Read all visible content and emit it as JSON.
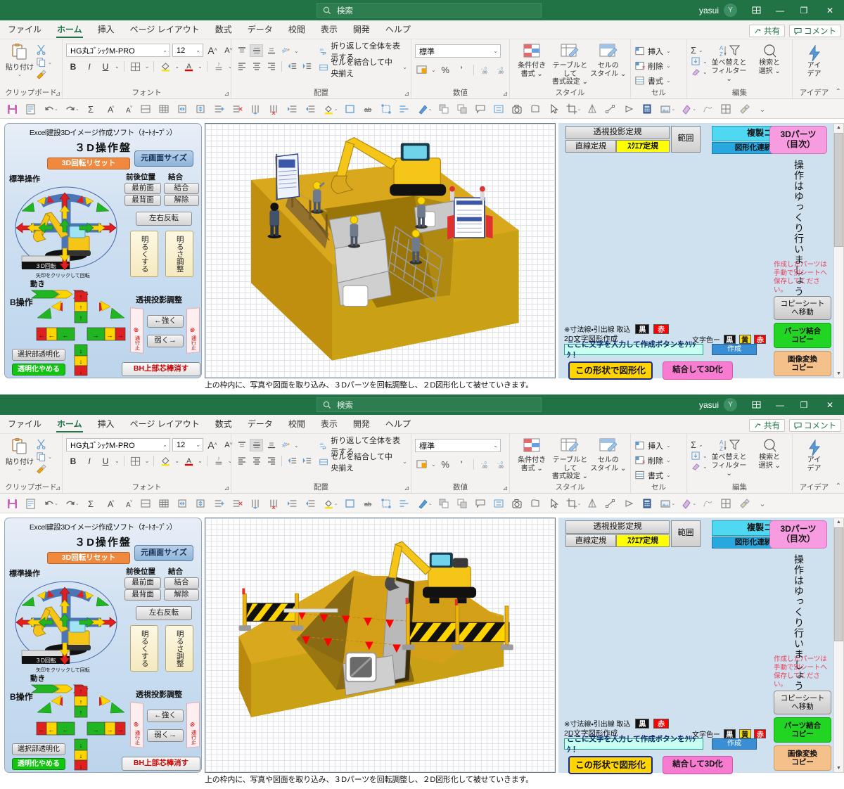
{
  "window": {
    "title": "Excel建設３Dイメージ作成ソフト",
    "title_caret": "▾",
    "search_placeholder": "検索",
    "user": "yasui",
    "avatar_initial": "Y",
    "restore_icon": "restore-window-icon",
    "minimize": "—",
    "maximize": "❐",
    "close": "✕"
  },
  "tabs": [
    {
      "label": "ファイル",
      "active": false
    },
    {
      "label": "ホーム",
      "active": true
    },
    {
      "label": "挿入",
      "active": false
    },
    {
      "label": "ページ レイアウト",
      "active": false
    },
    {
      "label": "数式",
      "active": false
    },
    {
      "label": "データ",
      "active": false
    },
    {
      "label": "校閲",
      "active": false
    },
    {
      "label": "表示",
      "active": false
    },
    {
      "label": "開発",
      "active": false
    },
    {
      "label": "ヘルプ",
      "active": false
    }
  ],
  "tabs_right": [
    {
      "label": "共有",
      "icon": "share-icon"
    },
    {
      "label": "コメント",
      "icon": "comment-icon"
    }
  ],
  "ribbon": {
    "clipboard": {
      "group_label": "クリップボード",
      "paste": "貼り付け",
      "cut_icon": "scissors-icon",
      "copy_icon": "copy-icon",
      "format_painter_icon": "format-painter-icon"
    },
    "font": {
      "group_label": "フォント",
      "font_name": "HG丸ｺﾞｼｯｸM-PRO",
      "font_size": "12",
      "grow": "A",
      "shrink": "A",
      "bold": "B",
      "italic": "I",
      "underline": "U",
      "borders_icon": "borders-icon",
      "fill_icon": "fill-color-icon",
      "font_color_icon": "font-color-icon",
      "phonetic_icon": "phonetic-guide-icon"
    },
    "alignment": {
      "group_label": "配置",
      "wrap_text": "折り返して全体を表示する",
      "merge_center": "セルを結合して中央揃え",
      "orientation_icon": "text-orientation-icon",
      "indent_decrease_icon": "indent-decrease-icon",
      "indent_increase_icon": "indent-increase-icon"
    },
    "number": {
      "group_label": "数値",
      "format": "標準",
      "accounting_icon": "accounting-format-icon",
      "percent": "%",
      "comma": "'",
      "inc_decimal_icon": "increase-decimal-icon",
      "dec_decimal_icon": "decrease-decimal-icon"
    },
    "styles": {
      "group_label": "スタイル",
      "conditional": "条件付き\n書式",
      "conditional_l1": "条件付き",
      "conditional_l2": "書式",
      "table_l1": "テーブルとして",
      "table_l2": "書式設定",
      "cellstyle_l1": "セルの",
      "cellstyle_l2": "スタイル"
    },
    "cells": {
      "group_label": "セル",
      "insert": "挿入",
      "delete": "削除",
      "format": "書式"
    },
    "editing": {
      "group_label": "編集",
      "sum_icon": "autosum-icon",
      "fill_icon": "fill-down-icon",
      "clear_icon": "clear-icon",
      "sort_l1": "並べ替えと",
      "sort_l2": "フィルター",
      "find_l1": "検索と",
      "find_l2": "選択"
    },
    "ideas": {
      "group_label": "アイデア",
      "l1": "アイ",
      "l2": "デア"
    },
    "collapse_icon": "collapse-ribbon-icon"
  },
  "quick_toolbar": [
    {
      "name": "save-icon",
      "caret": false
    },
    {
      "name": "print-preview-icon",
      "caret": false
    },
    {
      "name": "undo-icon",
      "caret": true
    },
    {
      "name": "redo-icon",
      "caret": true
    },
    {
      "name": "autosum-icon",
      "caret": false
    },
    {
      "name": "increase-font-icon",
      "caret": false
    },
    {
      "name": "decrease-font-icon",
      "caret": false
    },
    {
      "name": "merge-cells-icon",
      "caret": false
    },
    {
      "name": "all-borders-icon",
      "caret": false
    },
    {
      "name": "row-height-icon",
      "caret": false
    },
    {
      "name": "column-width-icon",
      "caret": false
    },
    {
      "name": "insert-row-icon",
      "caret": false
    },
    {
      "name": "delete-row-icon",
      "caret": false
    },
    {
      "name": "insert-column-icon",
      "caret": false
    },
    {
      "name": "delete-column-icon",
      "caret": false
    },
    {
      "name": "indent-increase-icon",
      "caret": false
    },
    {
      "name": "indent-decrease-icon",
      "caret": false
    },
    {
      "name": "fill-color-icon",
      "caret": true
    },
    {
      "name": "shape-outline-icon",
      "caret": false
    },
    {
      "name": "strikethrough-icon",
      "caret": false
    },
    {
      "name": "group-objects-icon",
      "caret": false
    },
    {
      "name": "align-objects-icon",
      "caret": false
    },
    {
      "name": "pen-icon",
      "caret": true
    },
    {
      "name": "bring-front-icon",
      "caret": false
    },
    {
      "name": "send-back-icon",
      "caret": false
    },
    {
      "name": "comment-icon",
      "caret": false
    },
    {
      "name": "selection-pane-icon",
      "caret": false
    },
    {
      "name": "camera-icon",
      "caret": false
    },
    {
      "name": "shape-icon",
      "caret": false
    },
    {
      "name": "select-arrow-icon",
      "caret": false
    },
    {
      "name": "crop-icon",
      "caret": true
    },
    {
      "name": "flip-icon",
      "caret": false
    },
    {
      "name": "edit-points-icon",
      "caret": false
    },
    {
      "name": "rotate-left-icon",
      "caret": false
    },
    {
      "name": "calculator-icon",
      "caret": false
    },
    {
      "name": "picture-icon",
      "caret": true
    },
    {
      "name": "eraser-icon",
      "caret": true
    },
    {
      "name": "freeform-icon",
      "caret": false
    },
    {
      "name": "insert-cells-icon",
      "caret": false
    },
    {
      "name": "format-painter-icon",
      "caret": false
    },
    {
      "name": "more-commands-icon",
      "caret": false
    }
  ],
  "control_panel": {
    "subtitle": "Excel建設3Dイメージ作成ソフト（ｵｰﾄｵｰﾌﾟﾝ）",
    "heading": "３D操作盤",
    "reset_button": "3D回転リセット",
    "original_size_button": "元画面サイズ",
    "standard_label": "標準操作",
    "zengo_label": "前後位置",
    "ketsugou_label": "結合",
    "front_button": "最前面",
    "back_button": "最背面",
    "join_button": "結合",
    "unjoin_button": "解除",
    "flip_button": "左右反転",
    "brighten_button": "明るくする",
    "brightness_button": "明るさ調整",
    "rotate_hint": "矢印をクリックして回転",
    "move_label": "動き",
    "b_operation_label": "B操作",
    "perspective_label": "透視投影調整",
    "stronger_button": "←強く",
    "weaker_button": "弱く→",
    "select_transparent_button": "選択部透明化",
    "stop_transparent_button": "透明化やめる",
    "bh_button": "BH上部芯棒消す",
    "rotate_base_label": "３D回転",
    "no_entry_sign": "通行止"
  },
  "right_panel": {
    "perspective_ruler": "透視投影定規",
    "line_ruler": "直線定規",
    "square_ruler": "ｽｸｴｱ定規",
    "range_button": "範囲",
    "duplicate_copy": "複製コピー",
    "shape_shrink_copy": "図形化連続縮小ｺﾋﾟｰ",
    "parts_3d_l1": "3Dパーツ",
    "parts_3d_l2": "（目次）",
    "vertical_note": "操作はゆっくり行いましょう。",
    "red_note": "作成したパーツは手動で別シートへ保存してください。",
    "copy_sheet_l1": "コピーシート",
    "copy_sheet_l2": "へ移動",
    "parts_join_l1": "パーツ結合",
    "parts_join_l2": "コピー",
    "image_conv_l1": "画像変換",
    "image_conv_l2": "コピー",
    "dimension_note": "※寸法線・引出線 取込",
    "chip_black": "黒",
    "chip_red": "赤",
    "chip_yellow": "黄",
    "text2d_label": "2D文字図形作成",
    "moji_color_label": "文字色ー",
    "text_input_value": "ここに文字を入力して作成ボタンをｸﾘｯｸ！",
    "create_button": "作成",
    "shape_button": "この形状で図形化",
    "to3d_button": "結合して3D化"
  },
  "canvas": {
    "status_note": "上の枠内に、写真や図面を取り込み、３Dパーツを回転調整し、２D図形化して被せていきます。",
    "top_scene": "construction-excavation-box-culvert-scene",
    "bottom_scene": "construction-embankment-culvert-scene"
  },
  "colors": {
    "excel_green": "#217346",
    "accent_orange": "#f0883e",
    "panel_blue": "#cfe0ef",
    "ground_yellow": "#d4a017",
    "excavator_yellow": "#f5c518",
    "warn_red": "#e8425a"
  }
}
